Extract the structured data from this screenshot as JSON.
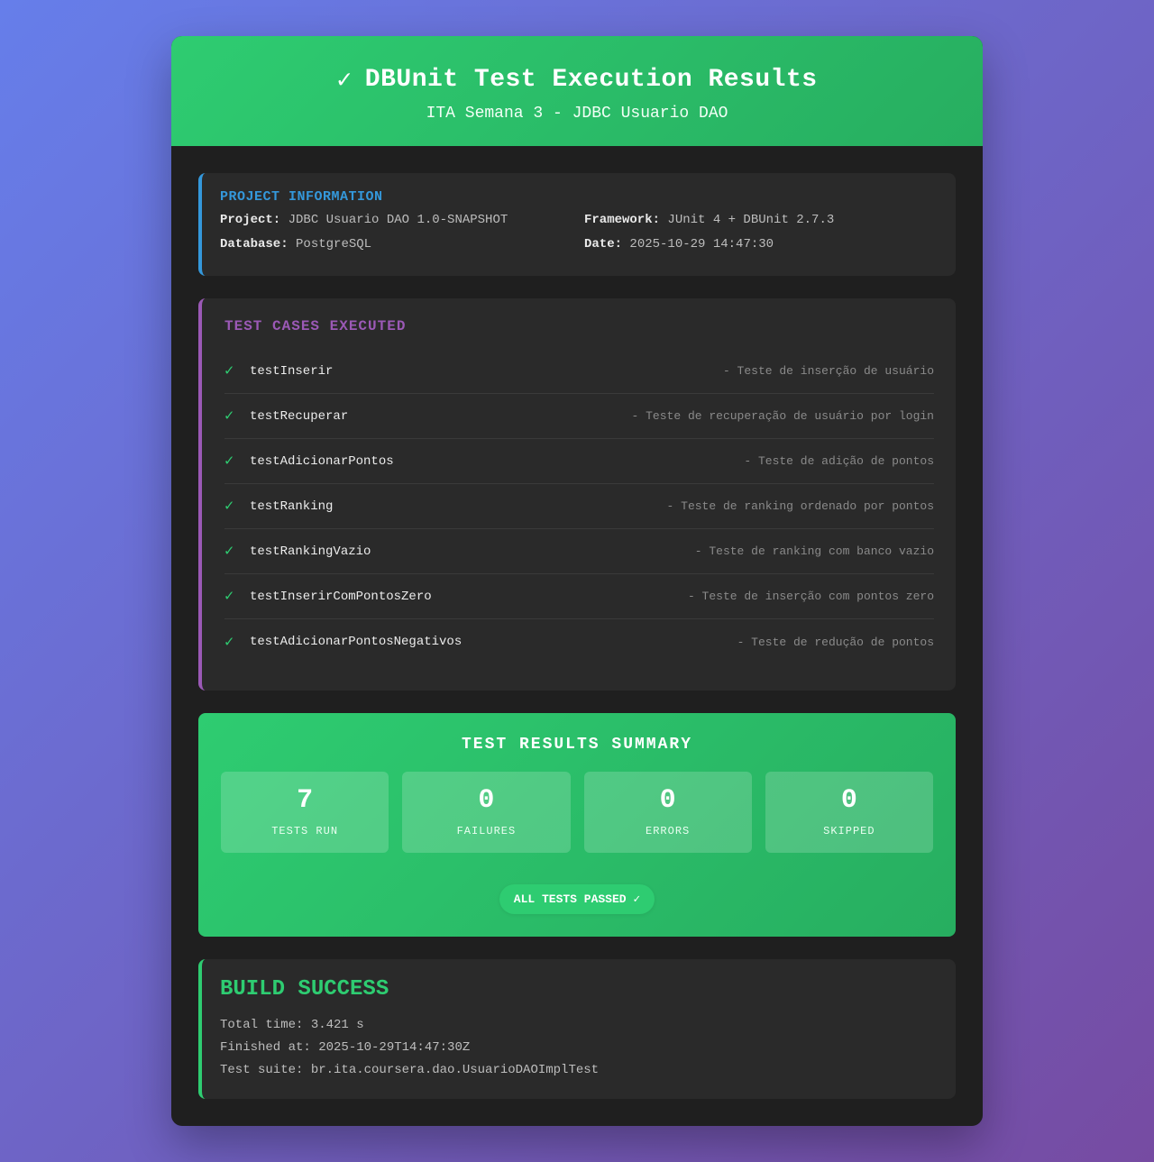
{
  "header": {
    "check": "✓",
    "title": "DBUnit Test Execution Results",
    "subtitle": "ITA Semana 3 - JDBC Usuario DAO"
  },
  "project_info": {
    "title": "PROJECT INFORMATION",
    "project_label": "Project:",
    "project_value": "JDBC Usuario DAO 1.0-SNAPSHOT",
    "framework_label": "Framework:",
    "framework_value": "JUnit 4 + DBUnit 2.7.3",
    "database_label": "Database:",
    "database_value": "PostgreSQL",
    "date_label": "Date:",
    "date_value": "2025-10-29 14:47:30"
  },
  "test_cases": {
    "title": "TEST CASES EXECUTED",
    "check": "✓",
    "items": [
      {
        "name": "testInserir",
        "desc": "- Teste de inserção de usuário"
      },
      {
        "name": "testRecuperar",
        "desc": "- Teste de recuperação de usuário por login"
      },
      {
        "name": "testAdicionarPontos",
        "desc": "- Teste de adição de pontos"
      },
      {
        "name": "testRanking",
        "desc": "- Teste de ranking ordenado por pontos"
      },
      {
        "name": "testRankingVazio",
        "desc": "- Teste de ranking com banco vazio"
      },
      {
        "name": "testInserirComPontosZero",
        "desc": "- Teste de inserção com pontos zero"
      },
      {
        "name": "testAdicionarPontosNegativos",
        "desc": "- Teste de redução de pontos"
      }
    ]
  },
  "summary": {
    "title": "TEST RESULTS SUMMARY",
    "stats": [
      {
        "value": "7",
        "label": "TESTS RUN"
      },
      {
        "value": "0",
        "label": "FAILURES"
      },
      {
        "value": "0",
        "label": "ERRORS"
      },
      {
        "value": "0",
        "label": "SKIPPED"
      }
    ],
    "badge": "ALL TESTS PASSED ✓"
  },
  "build": {
    "status": "BUILD SUCCESS",
    "total_time": "Total time: 3.421 s",
    "finished_at": "Finished at: 2025-10-29T14:47:30Z",
    "test_suite": "Test suite: br.ita.coursera.dao.UsuarioDAOImplTest"
  },
  "colors": {
    "accent_green": "#2ecc71",
    "info_blue": "#3498db",
    "cases_purple": "#9b59b6",
    "card_bg": "#1f1f1f",
    "section_bg": "#2a2a2a"
  }
}
